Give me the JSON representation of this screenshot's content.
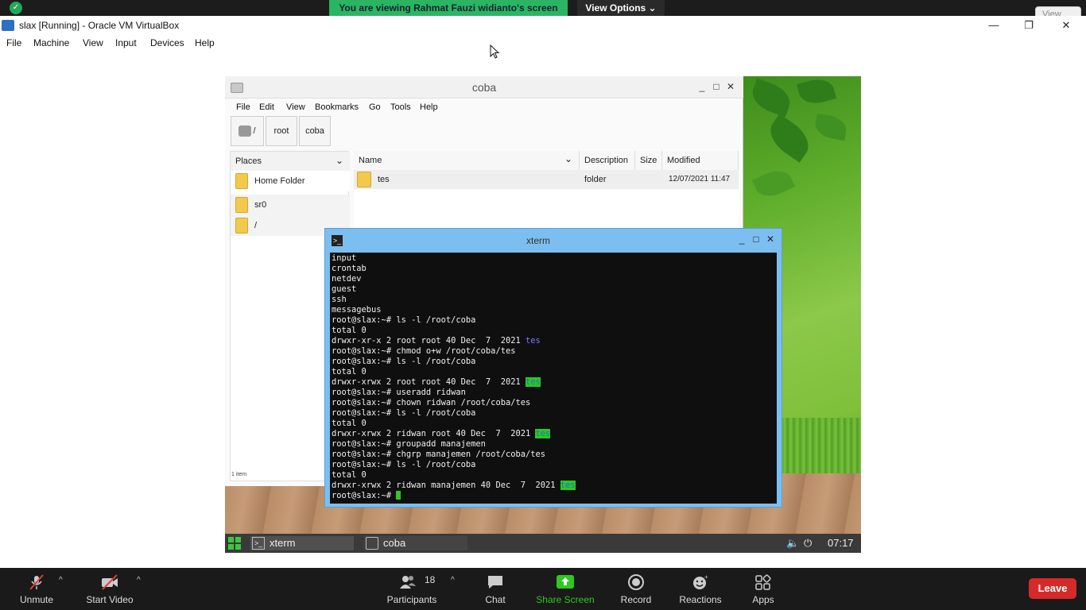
{
  "zoom_top": {
    "viewing_label": "You are viewing Rahmat Fauzi widianto's screen",
    "view_options_label": "View Options ⌄",
    "view_label": "View"
  },
  "vbox": {
    "title": "slax [Running] - Oracle VM VirtualBox",
    "minimize": "—",
    "restore": "❐",
    "close": "✕",
    "menu": [
      "File",
      "Machine",
      "View",
      "Input",
      "Devices",
      "Help"
    ]
  },
  "file_manager": {
    "title": "coba",
    "controls": [
      "_",
      "□",
      "✕"
    ],
    "menu": [
      "File",
      "Edit",
      "View",
      "Bookmarks",
      "Go",
      "Tools",
      "Help"
    ],
    "path": [
      "/",
      "root",
      "coba"
    ],
    "places_label": "Places",
    "places": [
      "Home Folder",
      "sr0",
      "/"
    ],
    "columns": [
      "Name",
      "Description",
      "Size",
      "Modified"
    ],
    "files": [
      {
        "name": "tes",
        "description": "folder",
        "size": "",
        "modified": "12/07/2021 11:47"
      }
    ],
    "status": "1 item"
  },
  "xterm": {
    "title": "xterm",
    "controls": [
      "_",
      "□",
      "✕"
    ],
    "lines": [
      "input",
      "crontab",
      "netdev",
      "guest",
      "ssh",
      "messagebus",
      "root@slax:~# ls -l /root/coba",
      "total 0",
      "drwxr-xr-x 2 root root 40 Dec  7  2021 ",
      "root@slax:~# chmod o+w /root/coba/tes",
      "root@slax:~# ls -l /root/coba",
      "total 0",
      "drwxr-xrwx 2 root root 40 Dec  7  2021 ",
      "root@slax:~# useradd ridwan",
      "root@slax:~# chown ridwan /root/coba/tes",
      "root@slax:~# ls -l /root/coba",
      "total 0",
      "drwxr-xrwx 2 ridwan root 40 Dec  7  2021 ",
      "root@slax:~# groupadd manajemen",
      "root@slax:~# chgrp manajemen /root/coba/tes",
      "root@slax:~# ls -l /root/coba",
      "total 0",
      "drwxr-xrwx 2 ridwan manajemen 40 Dec  7  2021 ",
      "root@slax:~# "
    ],
    "dir_name": "tes"
  },
  "taskbar": {
    "tasks": [
      "xterm",
      "coba"
    ],
    "volume_icon": "🔈",
    "power_icon": "⏻",
    "clock": "07:17"
  },
  "zoom_bar": {
    "unmute": "Unmute",
    "start_video": "Start Video",
    "participants": "Participants",
    "participants_count": "18",
    "chat": "Chat",
    "share_screen": "Share Screen",
    "record": "Record",
    "reactions": "Reactions",
    "apps": "Apps",
    "leave": "Leave"
  },
  "colors": {
    "share_green": "#2ec81f",
    "leave_red": "#d62a2a",
    "xterm_frame": "#7dbef0"
  }
}
